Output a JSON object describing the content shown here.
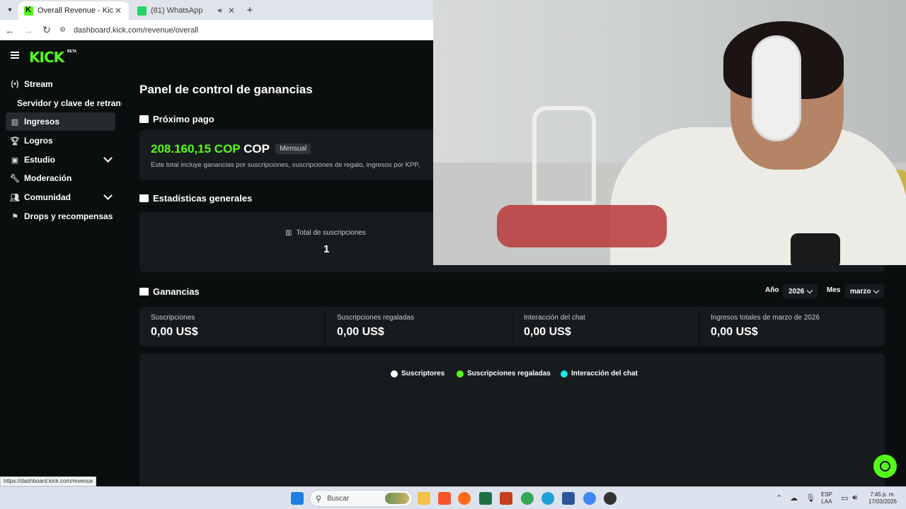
{
  "browser": {
    "tabs": [
      {
        "title": "Overall Revenue - Kick Dashbo",
        "active": true
      },
      {
        "title": "(81) WhatsApp",
        "active": false
      }
    ],
    "url": "dashboard.kick.com/revenue/overall",
    "status_url": "https://dashboard.kick.com/revenue"
  },
  "sidebar": {
    "logo": "KICK",
    "logo_badge": "BETA",
    "items": [
      {
        "label": "Stream",
        "icon": "broadcast-icon"
      },
      {
        "label": "Servidor y clave de retransmisión"
      },
      {
        "label": "Ingresos",
        "icon": "chart-icon",
        "active": true
      },
      {
        "label": "Logros",
        "icon": "trophy-icon"
      },
      {
        "label": "Estudio",
        "icon": "studio-icon",
        "expandable": true
      },
      {
        "label": "Moderación",
        "icon": "wrench-icon"
      },
      {
        "label": "Comunidad",
        "icon": "users-icon",
        "expandable": true
      },
      {
        "label": "Drops y recompensas",
        "icon": "gift-icon"
      }
    ]
  },
  "main": {
    "title": "Panel de control de ganancias",
    "next_payout": {
      "heading": "Próximo pago",
      "amount": "208.160,15 COP",
      "currency": "COP",
      "badge": "Mensual",
      "description": "Este total incluye ganancias por suscripciones, suscripciones de regalo, ingresos por KPP,"
    },
    "stats": {
      "heading": "Estadísticas generales",
      "total_subs_label": "Total de suscripciones",
      "total_subs_value": "1"
    },
    "earnings": {
      "heading": "Ganancias",
      "year_label": "Año",
      "year_value": "2026",
      "month_label": "Mes",
      "month_value": "marzo",
      "cells": [
        {
          "label": "Suscripciones",
          "value": "0,00 US$"
        },
        {
          "label": "Suscripciones regaladas",
          "value": "0,00 US$"
        },
        {
          "label": "Interacción del chat",
          "value": "0,00 US$"
        },
        {
          "label": "Ingresos totales de marzo de 2026",
          "value": "0,00 US$"
        }
      ],
      "legend": [
        {
          "label": "Suscriptores",
          "color": "#ffffff"
        },
        {
          "label": "Suscripciones regaladas",
          "color": "#53fc18"
        },
        {
          "label": "Interacción del chat",
          "color": "#1ee8e8"
        }
      ]
    }
  },
  "colors": {
    "accent": "#53fc18",
    "background": "#0b0e0f",
    "card": "#181b1e"
  },
  "taskbar": {
    "search_placeholder": "Buscar",
    "lang_top": "ESP",
    "lang_bottom": "LAA",
    "time": "7:45 p. m.",
    "date": "17/03/2026"
  }
}
